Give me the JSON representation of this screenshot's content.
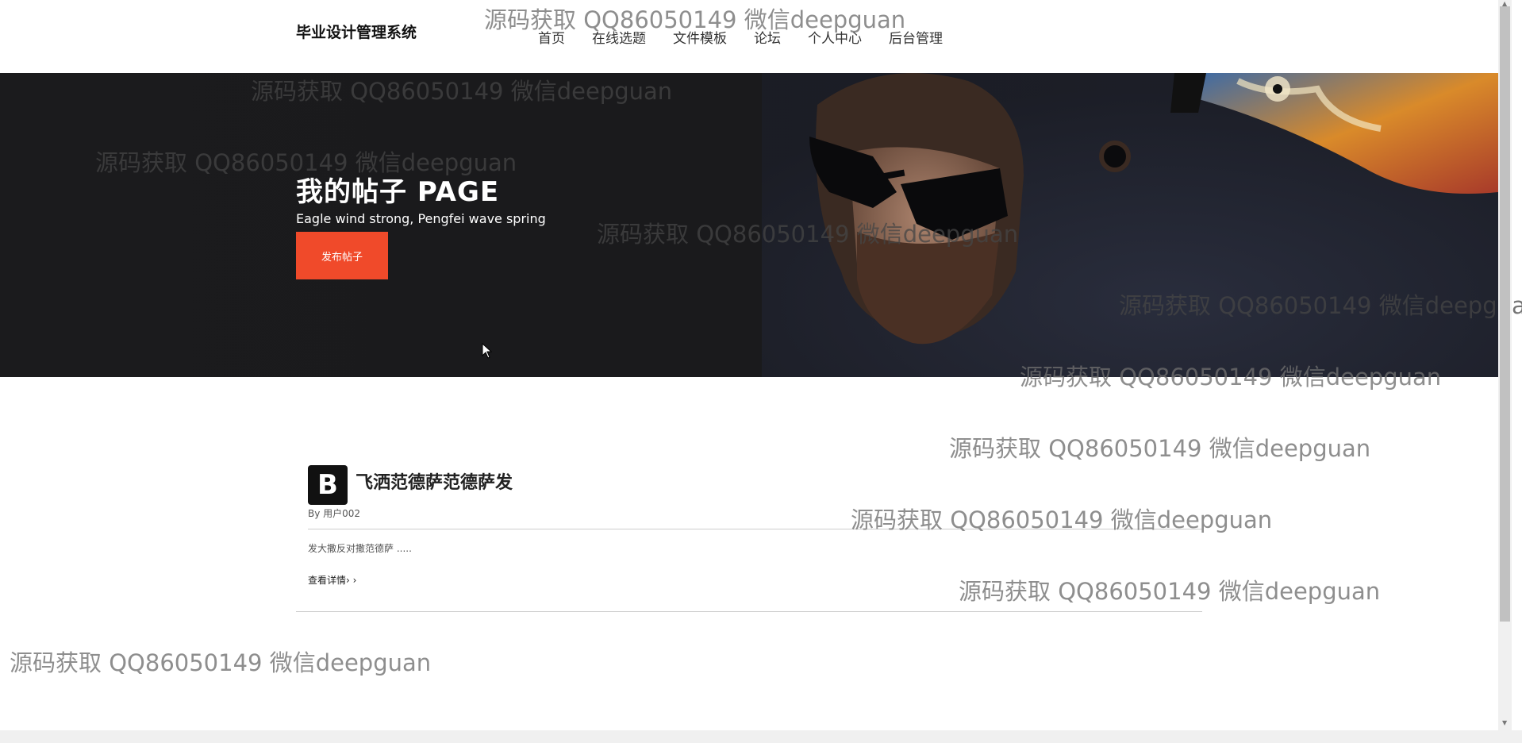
{
  "header": {
    "site_title": "毕业设计管理系统",
    "nav": [
      "首页",
      "在线选题",
      "文件模板",
      "论坛",
      "个人中心",
      "后台管理"
    ]
  },
  "hero": {
    "title": "我的帖子 PAGE",
    "subtitle": "Eagle wind strong, Pengfei wave spring",
    "button_label": "发布帖子"
  },
  "post": {
    "icon_letter": "B",
    "title": "飞洒范德萨范德萨发",
    "author": "By 用户002",
    "excerpt": "发大撒反对撒范德萨 .....",
    "more_label": "查看详情› ›"
  },
  "watermark": "源码获取 QQ86050149 微信deepguan",
  "colors": {
    "accent": "#f04a2a",
    "hero_bg": "#1b1b1d",
    "text": "#222222"
  }
}
